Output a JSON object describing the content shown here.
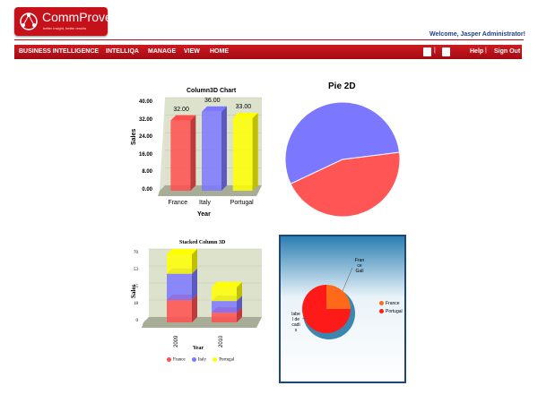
{
  "app": {
    "logo_name": "CommProve",
    "logo_tagline": "better insight, better results",
    "welcome": "Welcome, Jasper Administrator!"
  },
  "nav": {
    "items": [
      "BUSINESS INTELLIGENCE",
      "INTELLIQA",
      "MANAGE",
      "VIEW",
      "HOME"
    ],
    "separator": "|",
    "help": "Help",
    "signout": "Sign Out"
  },
  "chart_data": [
    {
      "type": "bar",
      "title": "Column3D Chart",
      "categories": [
        "France",
        "Italy",
        "Portugal"
      ],
      "values": [
        32,
        36,
        33
      ],
      "value_labels": [
        "32.00",
        "36.00",
        "33.00"
      ],
      "colors": [
        "#ff4e4e",
        "#7b78ff",
        "#ffff00"
      ],
      "xlabel": "Year",
      "ylabel": "Sales",
      "ylim": [
        0,
        40
      ],
      "yticks": [
        "40.00",
        "32.00",
        "24.00",
        "16.00",
        "8.00",
        "0.00"
      ]
    },
    {
      "type": "pie",
      "title": "Pie 2D",
      "values": [
        45,
        55
      ],
      "colors": [
        "#ff5555",
        "#7b78ff"
      ]
    },
    {
      "type": "bar",
      "title": "Stacked Column 3D",
      "categories": [
        "2009",
        "2010"
      ],
      "series": [
        {
          "name": "France",
          "values": [
            23,
            10
          ]
        },
        {
          "name": "Italy",
          "values": [
            27,
            12
          ]
        },
        {
          "name": "Portugal",
          "values": [
            20,
            14
          ]
        }
      ],
      "colors": [
        "#ff4e4e",
        "#7b78ff",
        "#ffff00"
      ],
      "xlabel": "Year",
      "ylabel": "Sales",
      "ylim": [
        0,
        70
      ],
      "yticks": [
        "70",
        "53",
        "35",
        "18",
        "0"
      ],
      "legend": "bottom"
    },
    {
      "type": "pie",
      "labels": [
        "France",
        "Portugal"
      ],
      "values": [
        25,
        75
      ],
      "colors": [
        "#ff6a1a",
        "#ff1a1a"
      ],
      "slice_labels": [
        "Fran\nce\nGall",
        "labe\nl de\ncadi\nx"
      ],
      "legend": "right"
    }
  ]
}
